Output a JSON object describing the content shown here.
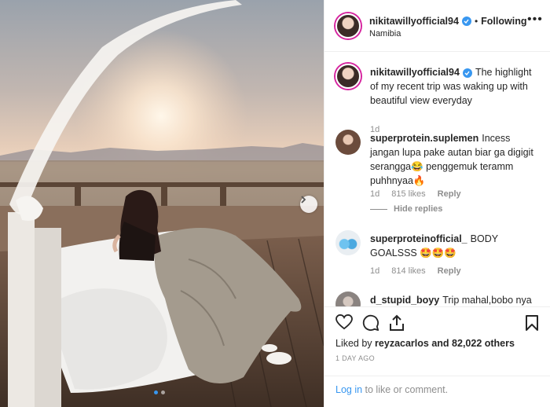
{
  "post": {
    "username": "nikitawillyofficial94",
    "separator": "•",
    "follow_label": "Following",
    "location": "Namibia",
    "more_label": "•••",
    "caption": "The highlight of my recent trip was waking up with beautiful view everyday",
    "caption_age": "1d"
  },
  "comments": [
    {
      "username": "superprotein.suplemen",
      "text": "Incess jangan lupa pake autan biar ga digigit serangga😂 penggemuk teramm puhhnyaa🔥",
      "age": "1d",
      "likes": "815 likes",
      "reply": "Reply",
      "hide_replies": "Hide replies"
    },
    {
      "username": "superproteinofficial_",
      "text": "BODY GOALSSS 🤩🤩🤩",
      "age": "1d",
      "likes": "814 likes",
      "reply": "Reply"
    },
    {
      "username": "d_stupid_boyy",
      "text": "Trip mahal,bobo nya di"
    }
  ],
  "actions": {
    "liked_by_prefix": "Liked by",
    "liked_by_user": "reyzacarlos",
    "liked_by_suffix": "and 82,022 others",
    "time_ago": "1 DAY AGO"
  },
  "footer": {
    "login_link": "Log in",
    "login_suffix": " to like or comment."
  },
  "colors": {
    "accent": "#3897f0",
    "muted": "#8e8e8e",
    "text": "#262626"
  }
}
